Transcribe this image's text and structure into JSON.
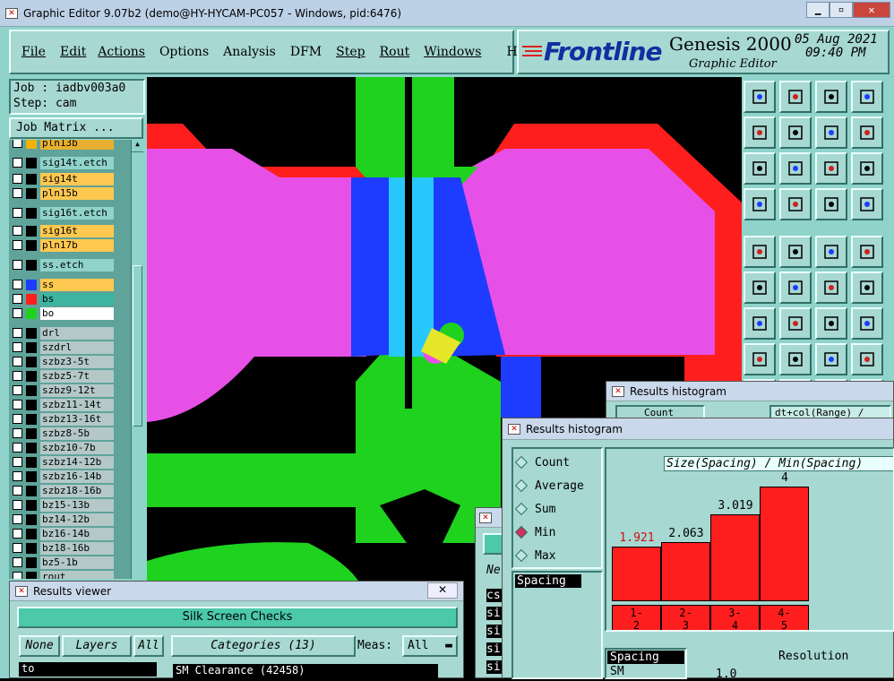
{
  "window": {
    "title": "Graphic Editor 9.07b2 (demo@HY-HYCAM-PC057 - Windows, pid:6476)"
  },
  "menu": [
    "File",
    "Edit",
    "Actions",
    "Options",
    "Analysis",
    "DFM",
    "Step",
    "Rout",
    "Windows",
    "Help"
  ],
  "brand": {
    "logo": "Frontline",
    "product": "Genesis 2000",
    "subtitle": "Graphic Editor",
    "date": "05 Aug 2021",
    "time": "09:40 PM"
  },
  "job": {
    "job_label": "Job : iadbv003a0",
    "step_label": "Step: cam",
    "matrix_button": "Job Matrix ..."
  },
  "layers": [
    {
      "name": "pln13b",
      "color": "#f0b400",
      "bg": "#e8b030"
    },
    {
      "name": "sig14t.etch",
      "color": "#000",
      "bg": "#8fd3cb"
    },
    {
      "name": "sig14t",
      "color": "#000",
      "bg": "#ffc850"
    },
    {
      "name": "pln15b",
      "color": "#000",
      "bg": "#ffc850"
    },
    {
      "name": "sig16t.etch",
      "color": "#000",
      "bg": "#8fd3cb"
    },
    {
      "name": "sig16t",
      "color": "#000",
      "bg": "#ffc850"
    },
    {
      "name": "pln17b",
      "color": "#000",
      "bg": "#ffc850"
    },
    {
      "name": "ss.etch",
      "color": "#000",
      "bg": "#8fd3cb"
    },
    {
      "name": "ss",
      "color": "#1e3cff",
      "bg": "#ffc850"
    },
    {
      "name": "bs",
      "color": "#ff1e1e",
      "bg": "#3cb4a0"
    },
    {
      "name": "bo",
      "color": "#1ed21e",
      "bg": "#ffffff"
    },
    {
      "name": "drl",
      "color": "#000",
      "bg": "#b4c8c8"
    },
    {
      "name": "szdrl",
      "color": "#000",
      "bg": "#b4c8c8"
    },
    {
      "name": "szbz3-5t",
      "color": "#000",
      "bg": "#b4c8c8"
    },
    {
      "name": "szbz5-7t",
      "color": "#000",
      "bg": "#b4c8c8"
    },
    {
      "name": "szbz9-12t",
      "color": "#000",
      "bg": "#b4c8c8"
    },
    {
      "name": "szbz11-14t",
      "color": "#000",
      "bg": "#b4c8c8"
    },
    {
      "name": "szbz13-16t",
      "color": "#000",
      "bg": "#b4c8c8"
    },
    {
      "name": "szbz8-5b",
      "color": "#000",
      "bg": "#b4c8c8"
    },
    {
      "name": "szbz10-7b",
      "color": "#000",
      "bg": "#b4c8c8"
    },
    {
      "name": "szbz14-12b",
      "color": "#000",
      "bg": "#b4c8c8"
    },
    {
      "name": "szbz16-14b",
      "color": "#000",
      "bg": "#b4c8c8"
    },
    {
      "name": "szbz18-16b",
      "color": "#000",
      "bg": "#b4c8c8"
    },
    {
      "name": "bz15-13b",
      "color": "#000",
      "bg": "#b4c8c8"
    },
    {
      "name": "bz14-12b",
      "color": "#000",
      "bg": "#b4c8c8"
    },
    {
      "name": "bz16-14b",
      "color": "#000",
      "bg": "#b4c8c8"
    },
    {
      "name": "bz18-16b",
      "color": "#000",
      "bg": "#b4c8c8"
    },
    {
      "name": "bz5-1b",
      "color": "#000",
      "bg": "#b4c8c8"
    },
    {
      "name": "rout",
      "color": "#000",
      "bg": "#b4c8c8"
    }
  ],
  "results_viewer": {
    "title": "Results viewer",
    "check_name": "Silk Screen Checks",
    "none_btn": "None",
    "layers_btn": "Layers",
    "all_btn": "All",
    "categories": "Categories (13)",
    "meas_label": "Meas:",
    "meas_value": "All",
    "filter_value": "to",
    "first_category": "SM Clearance (42458)"
  },
  "histogram_back": {
    "title": "Results histogram",
    "tab": "Count",
    "field": "dt+col(Range) /"
  },
  "histogram": {
    "title": "Results histogram",
    "options": [
      "Count",
      "Average",
      "Sum",
      "Min",
      "Max"
    ],
    "selected": "Min",
    "list_item": "Spacing",
    "lower_items": [
      "Spacing",
      "SM"
    ],
    "resolution_label": "Resolution",
    "resolution_value": "1.0",
    "chart_title": "Size(Spacing) / Min(Spacing)"
  },
  "chart_data": {
    "type": "bar",
    "title": "Size(Spacing) / Min(Spacing)",
    "categories": [
      "1-2",
      "2-3",
      "3-4",
      "4-5"
    ],
    "values": [
      1.921,
      2.063,
      3.019,
      4
    ],
    "labels": [
      "1.921",
      "2.063",
      "3.019",
      "4"
    ]
  },
  "cropped_labels": {
    "ne": "Ne",
    "cs": "cs",
    "si": "si"
  }
}
